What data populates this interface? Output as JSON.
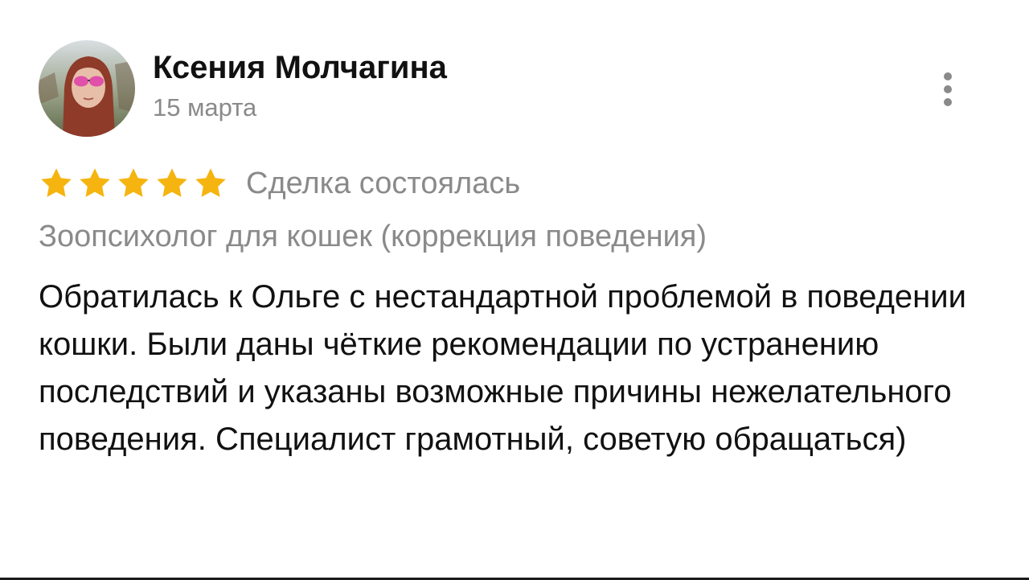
{
  "review": {
    "author_name": "Ксения Молчагина",
    "date": "15 марта",
    "rating": 5,
    "rating_max": 5,
    "deal_status": "Сделка состоялась",
    "service": "Зоопсихолог для кошек (коррекция поведения)",
    "text": "Обратилась к Ольге с нестандартной проблемой в поведении кошки. Были даны чёткие рекомендации по устранению последствий и указаны возможные причины нежелательного поведения. Специалист грамотный, советую обращаться)"
  },
  "colors": {
    "star": "#f5b40f",
    "secondary_text": "#8a8a8a",
    "primary_text": "#111111"
  },
  "icons": {
    "more": "more-vertical-icon",
    "star": "star-icon"
  }
}
